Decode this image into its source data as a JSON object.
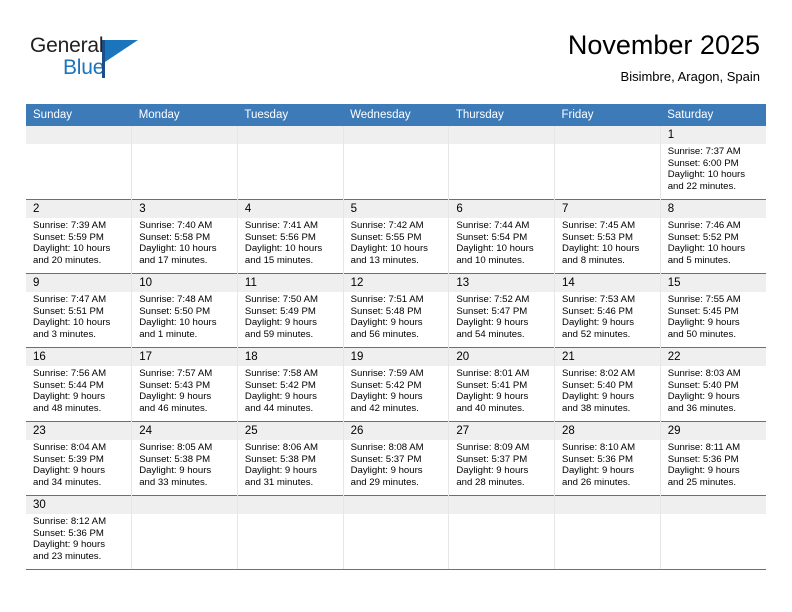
{
  "brand": {
    "name_part1": "General",
    "name_part2": "Blue",
    "logo_icon": "general-blue-flag-logo"
  },
  "header": {
    "month_title": "November 2025",
    "location": "Bisimbre, Aragon, Spain"
  },
  "theme": {
    "header_blue": "#3d7ab8",
    "daynum_band": "#efefef",
    "brand_blue": "#1b75bc",
    "grid_line": "#e6e6e6",
    "text": "#000000"
  },
  "calendar": {
    "weekday_headers": [
      "Sunday",
      "Monday",
      "Tuesday",
      "Wednesday",
      "Thursday",
      "Friday",
      "Saturday"
    ],
    "labels": {
      "sunrise": "Sunrise:",
      "sunset": "Sunset:",
      "daylight": "Daylight:"
    },
    "weeks": [
      [
        {
          "day": "",
          "empty": true
        },
        {
          "day": "",
          "empty": true
        },
        {
          "day": "",
          "empty": true
        },
        {
          "day": "",
          "empty": true
        },
        {
          "day": "",
          "empty": true
        },
        {
          "day": "",
          "empty": true
        },
        {
          "day": "1",
          "sunrise": "Sunrise: 7:37 AM",
          "sunset": "Sunset: 6:00 PM",
          "daylight1": "Daylight: 10 hours",
          "daylight2": "and 22 minutes."
        }
      ],
      [
        {
          "day": "2",
          "sunrise": "Sunrise: 7:39 AM",
          "sunset": "Sunset: 5:59 PM",
          "daylight1": "Daylight: 10 hours",
          "daylight2": "and 20 minutes."
        },
        {
          "day": "3",
          "sunrise": "Sunrise: 7:40 AM",
          "sunset": "Sunset: 5:58 PM",
          "daylight1": "Daylight: 10 hours",
          "daylight2": "and 17 minutes."
        },
        {
          "day": "4",
          "sunrise": "Sunrise: 7:41 AM",
          "sunset": "Sunset: 5:56 PM",
          "daylight1": "Daylight: 10 hours",
          "daylight2": "and 15 minutes."
        },
        {
          "day": "5",
          "sunrise": "Sunrise: 7:42 AM",
          "sunset": "Sunset: 5:55 PM",
          "daylight1": "Daylight: 10 hours",
          "daylight2": "and 13 minutes."
        },
        {
          "day": "6",
          "sunrise": "Sunrise: 7:44 AM",
          "sunset": "Sunset: 5:54 PM",
          "daylight1": "Daylight: 10 hours",
          "daylight2": "and 10 minutes."
        },
        {
          "day": "7",
          "sunrise": "Sunrise: 7:45 AM",
          "sunset": "Sunset: 5:53 PM",
          "daylight1": "Daylight: 10 hours",
          "daylight2": "and 8 minutes."
        },
        {
          "day": "8",
          "sunrise": "Sunrise: 7:46 AM",
          "sunset": "Sunset: 5:52 PM",
          "daylight1": "Daylight: 10 hours",
          "daylight2": "and 5 minutes."
        }
      ],
      [
        {
          "day": "9",
          "sunrise": "Sunrise: 7:47 AM",
          "sunset": "Sunset: 5:51 PM",
          "daylight1": "Daylight: 10 hours",
          "daylight2": "and 3 minutes."
        },
        {
          "day": "10",
          "sunrise": "Sunrise: 7:48 AM",
          "sunset": "Sunset: 5:50 PM",
          "daylight1": "Daylight: 10 hours",
          "daylight2": "and 1 minute."
        },
        {
          "day": "11",
          "sunrise": "Sunrise: 7:50 AM",
          "sunset": "Sunset: 5:49 PM",
          "daylight1": "Daylight: 9 hours",
          "daylight2": "and 59 minutes."
        },
        {
          "day": "12",
          "sunrise": "Sunrise: 7:51 AM",
          "sunset": "Sunset: 5:48 PM",
          "daylight1": "Daylight: 9 hours",
          "daylight2": "and 56 minutes."
        },
        {
          "day": "13",
          "sunrise": "Sunrise: 7:52 AM",
          "sunset": "Sunset: 5:47 PM",
          "daylight1": "Daylight: 9 hours",
          "daylight2": "and 54 minutes."
        },
        {
          "day": "14",
          "sunrise": "Sunrise: 7:53 AM",
          "sunset": "Sunset: 5:46 PM",
          "daylight1": "Daylight: 9 hours",
          "daylight2": "and 52 minutes."
        },
        {
          "day": "15",
          "sunrise": "Sunrise: 7:55 AM",
          "sunset": "Sunset: 5:45 PM",
          "daylight1": "Daylight: 9 hours",
          "daylight2": "and 50 minutes."
        }
      ],
      [
        {
          "day": "16",
          "sunrise": "Sunrise: 7:56 AM",
          "sunset": "Sunset: 5:44 PM",
          "daylight1": "Daylight: 9 hours",
          "daylight2": "and 48 minutes."
        },
        {
          "day": "17",
          "sunrise": "Sunrise: 7:57 AM",
          "sunset": "Sunset: 5:43 PM",
          "daylight1": "Daylight: 9 hours",
          "daylight2": "and 46 minutes."
        },
        {
          "day": "18",
          "sunrise": "Sunrise: 7:58 AM",
          "sunset": "Sunset: 5:42 PM",
          "daylight1": "Daylight: 9 hours",
          "daylight2": "and 44 minutes."
        },
        {
          "day": "19",
          "sunrise": "Sunrise: 7:59 AM",
          "sunset": "Sunset: 5:42 PM",
          "daylight1": "Daylight: 9 hours",
          "daylight2": "and 42 minutes."
        },
        {
          "day": "20",
          "sunrise": "Sunrise: 8:01 AM",
          "sunset": "Sunset: 5:41 PM",
          "daylight1": "Daylight: 9 hours",
          "daylight2": "and 40 minutes."
        },
        {
          "day": "21",
          "sunrise": "Sunrise: 8:02 AM",
          "sunset": "Sunset: 5:40 PM",
          "daylight1": "Daylight: 9 hours",
          "daylight2": "and 38 minutes."
        },
        {
          "day": "22",
          "sunrise": "Sunrise: 8:03 AM",
          "sunset": "Sunset: 5:40 PM",
          "daylight1": "Daylight: 9 hours",
          "daylight2": "and 36 minutes."
        }
      ],
      [
        {
          "day": "23",
          "sunrise": "Sunrise: 8:04 AM",
          "sunset": "Sunset: 5:39 PM",
          "daylight1": "Daylight: 9 hours",
          "daylight2": "and 34 minutes."
        },
        {
          "day": "24",
          "sunrise": "Sunrise: 8:05 AM",
          "sunset": "Sunset: 5:38 PM",
          "daylight1": "Daylight: 9 hours",
          "daylight2": "and 33 minutes."
        },
        {
          "day": "25",
          "sunrise": "Sunrise: 8:06 AM",
          "sunset": "Sunset: 5:38 PM",
          "daylight1": "Daylight: 9 hours",
          "daylight2": "and 31 minutes."
        },
        {
          "day": "26",
          "sunrise": "Sunrise: 8:08 AM",
          "sunset": "Sunset: 5:37 PM",
          "daylight1": "Daylight: 9 hours",
          "daylight2": "and 29 minutes."
        },
        {
          "day": "27",
          "sunrise": "Sunrise: 8:09 AM",
          "sunset": "Sunset: 5:37 PM",
          "daylight1": "Daylight: 9 hours",
          "daylight2": "and 28 minutes."
        },
        {
          "day": "28",
          "sunrise": "Sunrise: 8:10 AM",
          "sunset": "Sunset: 5:36 PM",
          "daylight1": "Daylight: 9 hours",
          "daylight2": "and 26 minutes."
        },
        {
          "day": "29",
          "sunrise": "Sunrise: 8:11 AM",
          "sunset": "Sunset: 5:36 PM",
          "daylight1": "Daylight: 9 hours",
          "daylight2": "and 25 minutes."
        }
      ],
      [
        {
          "day": "30",
          "sunrise": "Sunrise: 8:12 AM",
          "sunset": "Sunset: 5:36 PM",
          "daylight1": "Daylight: 9 hours",
          "daylight2": "and 23 minutes."
        },
        {
          "day": "",
          "empty": true
        },
        {
          "day": "",
          "empty": true
        },
        {
          "day": "",
          "empty": true
        },
        {
          "day": "",
          "empty": true
        },
        {
          "day": "",
          "empty": true
        },
        {
          "day": "",
          "empty": true
        }
      ]
    ]
  }
}
